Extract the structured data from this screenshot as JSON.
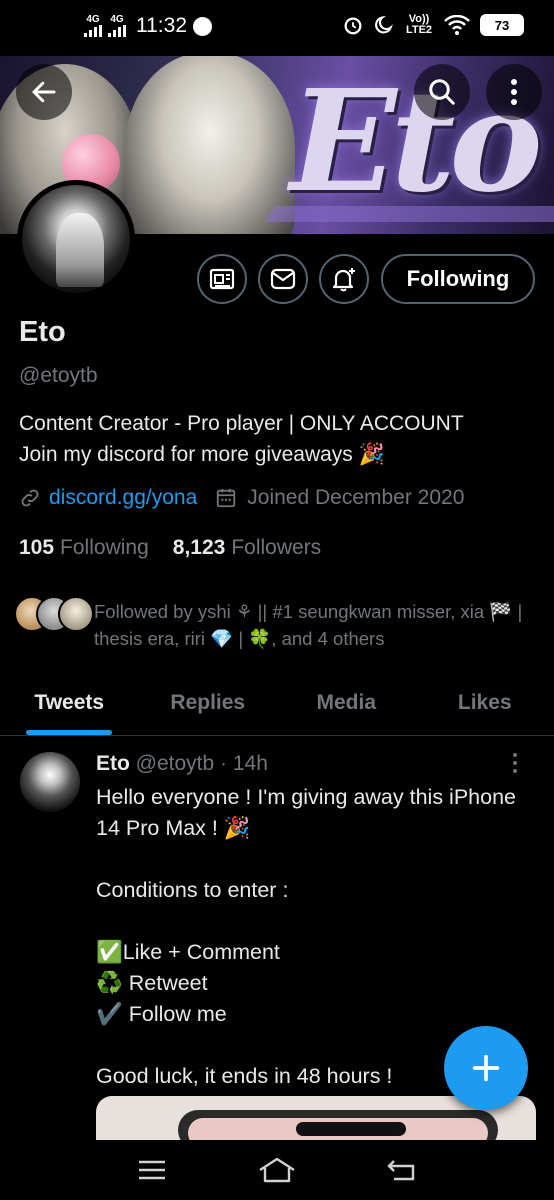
{
  "status_bar": {
    "network_1": "4G",
    "network_2": "4G",
    "time": "11:32",
    "volte": "Vo)) LTE2",
    "battery": "73"
  },
  "banner": {
    "logo_text": "Eto"
  },
  "profile": {
    "name": "Eto",
    "handle": "@etoytb",
    "bio_line1": "Content Creator - Pro player | ONLY ACCOUNT",
    "bio_line2": "Join my discord for more giveaways 🎉",
    "link": "discord.gg/yona",
    "joined": "Joined December 2020",
    "following_count": "105",
    "following_label": "Following",
    "followers_count": "8,123",
    "followers_label": "Followers",
    "followed_by": "Followed by yshi ⚘ || #1 seungkwan misser, xia 🏁 | thesis era, riri 💎 | 🍀, and 4 others",
    "follow_button": "Following"
  },
  "tabs": [
    {
      "label": "Tweets"
    },
    {
      "label": "Replies"
    },
    {
      "label": "Media"
    },
    {
      "label": "Likes"
    }
  ],
  "tweet": {
    "author": "Eto",
    "handle": "@etoytb",
    "time": "· 14h",
    "text": "Hello everyone ! I'm giving away this iPhone 14 Pro Max ! 🎉\n\nConditions to enter :\n\n✅Like + Comment\n♻️ Retweet\n✔️ Follow me\n\nGood luck, it ends in 48 hours !"
  },
  "icons": {
    "back": "arrow-left-icon",
    "search": "search-icon",
    "more": "more-vertical-icon",
    "newsletter": "newsletter-icon",
    "message": "envelope-icon",
    "notify": "bell-plus-icon",
    "link": "link-icon",
    "calendar": "calendar-icon",
    "compose": "plus-icon"
  },
  "colors": {
    "accent": "#1d9bf0",
    "background": "#000000",
    "text": "#e7e9ea",
    "muted": "#71767b"
  }
}
